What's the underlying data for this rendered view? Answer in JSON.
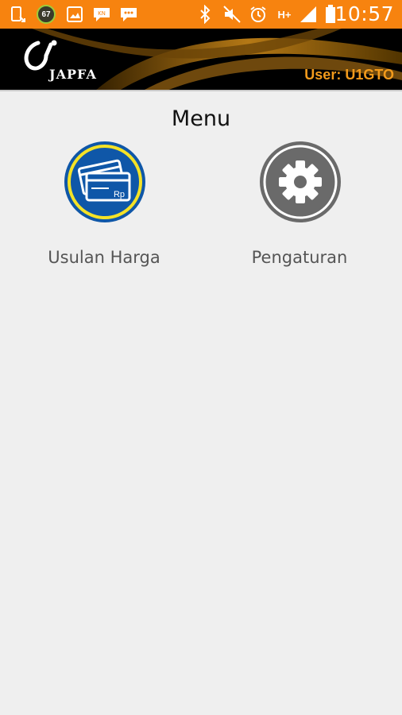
{
  "status_bar": {
    "time": "10:57",
    "notification_icons": [
      "phone-icon",
      "battery-67-icon",
      "image-icon",
      "chat-icon",
      "message-icon"
    ],
    "badge_value": "67",
    "system_icons": [
      "bluetooth-icon",
      "mute-icon",
      "alarm-icon",
      "network-h-plus-icon",
      "signal-icon",
      "battery-icon"
    ],
    "network_label": "H+",
    "color": "#f7830f"
  },
  "header": {
    "brand": "JAPFA",
    "user_label": "User: U1GTO",
    "user_color": "#f29a1c"
  },
  "main": {
    "title": "Menu",
    "items": [
      {
        "label": "Usulan Harga",
        "icon": "price-card-icon",
        "icon_text": "Rp"
      },
      {
        "label": "Pengaturan",
        "icon": "gear-icon"
      }
    ]
  }
}
